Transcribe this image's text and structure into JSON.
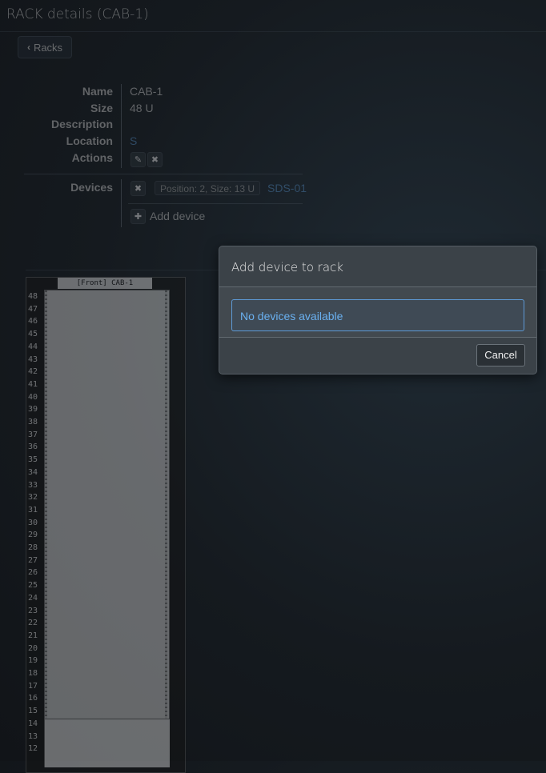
{
  "page": {
    "title": "RACK details (CAB-1)"
  },
  "nav": {
    "back_label": "Racks"
  },
  "details": {
    "name_label": "Name",
    "name_value": "CAB-1",
    "size_label": "Size",
    "size_value": "48 U",
    "description_label": "Description",
    "location_label": "Location",
    "location_value": "S",
    "actions_label": "Actions"
  },
  "devices": {
    "label": "Devices",
    "items": [
      {
        "position_info": "Position: 2, Size: 13 U",
        "name": "SDS-01"
      }
    ],
    "add_label": "Add device"
  },
  "rack": {
    "header": "[Front] CAB-1",
    "units": [
      "48",
      "47",
      "46",
      "45",
      "44",
      "43",
      "42",
      "41",
      "40",
      "39",
      "38",
      "37",
      "36",
      "35",
      "34",
      "33",
      "32",
      "31",
      "30",
      "29",
      "28",
      "27",
      "26",
      "25",
      "24",
      "23",
      "22",
      "21",
      "20",
      "19",
      "18",
      "17",
      "16",
      "15",
      "14",
      "13",
      "12"
    ]
  },
  "modal": {
    "title": "Add device to rack",
    "empty_message": "No devices available",
    "cancel_label": "Cancel"
  },
  "colors": {
    "link": "#4f84b8",
    "accent": "#5e9ad6",
    "background": "#151a1f"
  }
}
